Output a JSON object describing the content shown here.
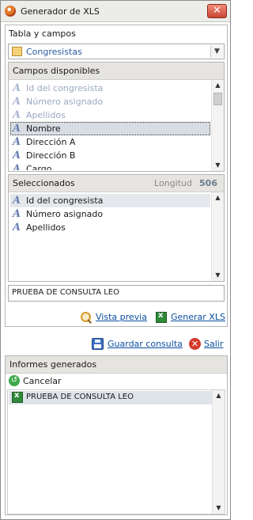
{
  "window": {
    "title": "Generador de XLS",
    "close_glyph": "✕"
  },
  "table_section": {
    "label": "Tabla y campos",
    "selected_table": "Congresistas"
  },
  "available_fields": {
    "header": "Campos disponibles",
    "items": [
      {
        "label": "Id del congresista",
        "state": "disabled"
      },
      {
        "label": "Número asignado",
        "state": "disabled"
      },
      {
        "label": "Apellidos",
        "state": "disabled"
      },
      {
        "label": "Nombre",
        "state": "selected"
      },
      {
        "label": "Dirección A",
        "state": "normal"
      },
      {
        "label": "Dirección B",
        "state": "normal"
      },
      {
        "label": "Cargo",
        "state": "normal"
      }
    ]
  },
  "selected_fields": {
    "header": "Seleccionados",
    "length_label": "Longitud",
    "length_value": "506",
    "items": [
      {
        "label": "Id del congresista",
        "state": "highlight"
      },
      {
        "label": "Número asignado",
        "state": "normal"
      },
      {
        "label": "Apellidos",
        "state": "normal"
      }
    ]
  },
  "query_name": "PRUEBA DE CONSULTA LEO",
  "actions": {
    "preview": "Vista previa",
    "generate": "Generar XLS",
    "save_query": "Guardar consulta",
    "exit": "Salir"
  },
  "reports": {
    "header": "Informes generados",
    "cancel": "Cancelar",
    "items": [
      {
        "label": "PRUEBA DE CONSULTA LEO"
      }
    ]
  },
  "icons": {
    "field_icon": "A",
    "scroll_up": "▲",
    "scroll_down": "▼",
    "dropdown": "▼",
    "exit": "✕",
    "cancel": "↺"
  }
}
